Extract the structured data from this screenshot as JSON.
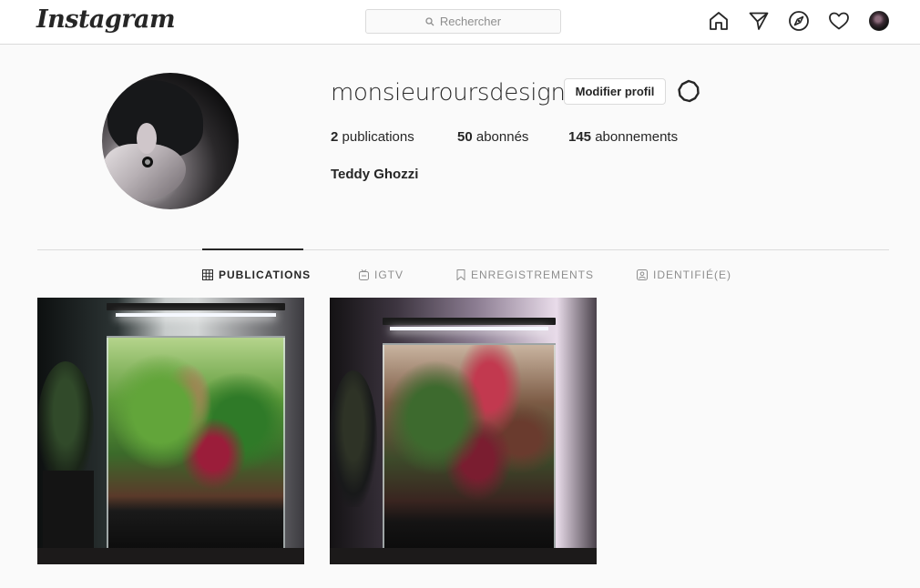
{
  "header": {
    "logo": "Instagram",
    "search_placeholder": "Rechercher",
    "icons": [
      "home-icon",
      "direct-icon",
      "explore-icon",
      "activity-icon",
      "avatar"
    ]
  },
  "profile": {
    "username": "monsieuroursdesign",
    "edit_button": "Modifier profil",
    "stats": [
      {
        "count": "2",
        "label": " publications"
      },
      {
        "count": "50",
        "label": " abonnés"
      },
      {
        "count": "145",
        "label": " abonnements"
      }
    ],
    "full_name": "Teddy Ghozzi"
  },
  "tabs": [
    {
      "label": "PUBLICATIONS",
      "icon": "grid-icon",
      "active": true
    },
    {
      "label": "IGTV",
      "icon": "igtv-icon",
      "active": false
    },
    {
      "label": "ENREGISTREMENTS",
      "icon": "bookmark-icon",
      "active": false
    },
    {
      "label": "IDENTIFIÉ(E)",
      "icon": "tagged-icon",
      "active": false
    }
  ],
  "posts_count": 2,
  "colors": {
    "background": "#fafafa",
    "border": "#dbdbdb",
    "text": "#262626",
    "muted": "#8e8e8e"
  }
}
